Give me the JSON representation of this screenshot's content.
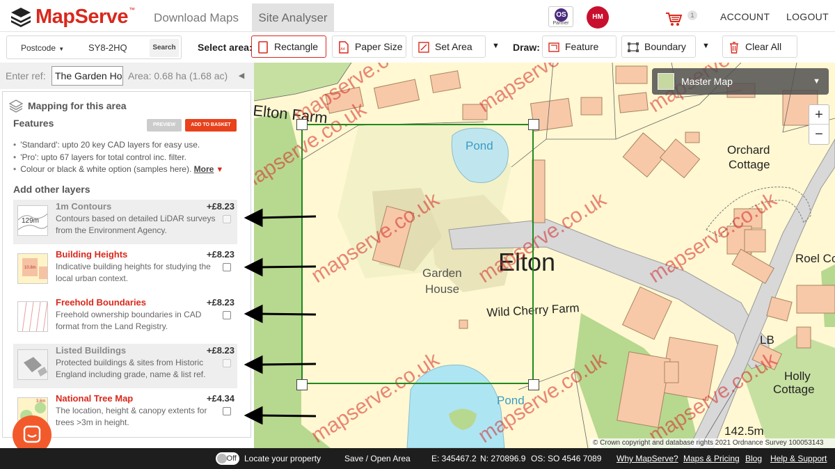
{
  "header": {
    "logo_text": "MapServe",
    "logo_tm": "™",
    "tabs": [
      {
        "label": "Download Maps",
        "active": false
      },
      {
        "label": "Site Analyser",
        "active": true
      }
    ],
    "partner_badge_text": "Partner",
    "partner_badge_letters": "OS",
    "hm_badge_letters": "HM",
    "basket_count": "1",
    "account_label": "ACCOUNT",
    "logout_label": "LOGOUT"
  },
  "toolbar": {
    "search_type": "Postcode",
    "postcode": "SY8-2HQ",
    "search_label": "Search",
    "select_area_label": "Select area:",
    "select_tools": [
      {
        "label": "Rectangle",
        "icon": "rectangle-icon",
        "active": true
      },
      {
        "label": "Paper Size",
        "icon": "paper-size-icon",
        "active": false
      },
      {
        "label": "Set Area",
        "icon": "set-area-icon",
        "active": false
      }
    ],
    "draw_label": "Draw:",
    "draw_tools": [
      {
        "label": "Feature",
        "icon": "feature-icon"
      },
      {
        "label": "Boundary",
        "icon": "boundary-icon"
      },
      {
        "label": "Clear All",
        "icon": "trash-icon"
      }
    ]
  },
  "sidebar": {
    "ref_label": "Enter ref:",
    "ref_value": "The Garden Ho",
    "area_text": "Area: 0.68 ha (1.68 ac)",
    "panel_title": "Mapping for this area",
    "features_title": "Features",
    "preview_label": "PREVIEW",
    "add_to_basket_label": "ADD TO BASKET",
    "features": [
      "'Standard': upto 20 key CAD layers for easy use.",
      "'Pro': upto 67 layers for total control inc. filter.",
      "Colour or black & white option (samples here)."
    ],
    "more_label": "More",
    "add_layers_title": "Add other layers",
    "layers": [
      {
        "name": "1m Contours",
        "price": "+£8.23",
        "description": "Contours based on detailed LiDAR surveys from the Environment Agency.",
        "thumb_text": "129m",
        "available": false
      },
      {
        "name": "Building Heights",
        "price": "+£8.23",
        "description": "Indicative building heights for studying the local urban context.",
        "thumb_text": "10.8m",
        "available": true
      },
      {
        "name": "Freehold Boundaries",
        "price": "+£8.23",
        "description": "Freehold ownership boundaries in CAD format from the Land Registry.",
        "thumb_text": "",
        "available": true
      },
      {
        "name": "Listed Buildings",
        "price": "+£8.23",
        "description": "Protected buildings & sites from Historic England including grade, name & list ref.",
        "thumb_text": "",
        "available": false
      },
      {
        "name": "National Tree Map",
        "price": "+£4.34",
        "description": "The location, height & canopy extents for trees >3m in height.",
        "thumb_text": "3.6m",
        "available": true
      }
    ]
  },
  "map": {
    "layer_select": "Master Map",
    "zoom_in": "+",
    "zoom_out": "−",
    "labels": {
      "elton_farm": "Elton Farm",
      "pond_north": "Pond",
      "orchard_line1": "Orchard",
      "orchard_line2": "Cottage",
      "elton": "Elton",
      "garden_line1": "Garden",
      "garden_line2": "House",
      "wild_cherry": "Wild Cherry Farm",
      "roel": "Roel Co",
      "lb": "LB",
      "holly_line1": "Holly",
      "holly_line2": "Cottage",
      "pond_south": "Pond",
      "spot_height": "142.5m"
    },
    "watermark_text": "mapserve.co.uk",
    "copyright": "© Crown copyright and database rights 2021 Ordnance Survey 100053143"
  },
  "footer": {
    "toggle_label": "Off",
    "locate_label": "Locate your property",
    "save_label": "Save / Open Area",
    "easting": "E: 345467.2",
    "northing": "N: 270896.9",
    "os_ref": "OS: SO 4546 7089",
    "links": [
      "Why MapServe?",
      "Maps & Pricing",
      "Blog",
      "Help & Support"
    ]
  },
  "colors": {
    "brand_red": "#d9281c",
    "cta_orange": "#e8411c",
    "selection_green": "#1e8a1e",
    "map_building": "#f7c9a8",
    "map_land": "#fff8d2",
    "map_grass": "#b9da97",
    "map_water": "#bfe6ee"
  }
}
